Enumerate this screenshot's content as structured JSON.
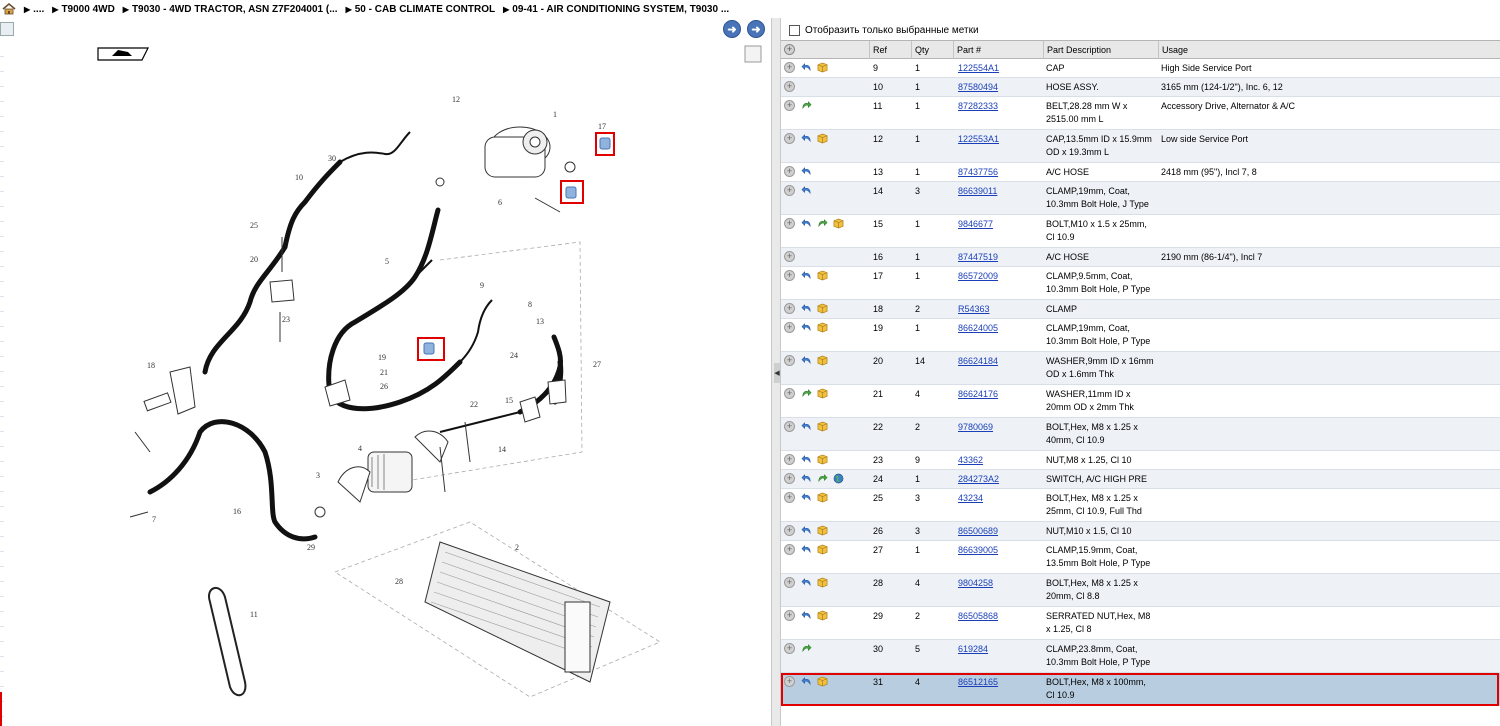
{
  "breadcrumb": {
    "items": [
      "....",
      "T9000 4WD",
      "T9030 - 4WD TRACTOR, ASN Z7F204001 (...",
      "50 - CAB CLIMATE CONTROL",
      "09-41 - AIR CONDITIONING SYSTEM, T9030 ..."
    ]
  },
  "icons": {
    "home": "home-icon",
    "back": "arrow-left-icon",
    "forward": "arrow-right-icon",
    "expand": "plus-circle-icon",
    "alternate": "blue-arrow-icon",
    "replacement": "green-arrow-icon",
    "package": "package-icon",
    "globe": "globe-icon"
  },
  "colors": {
    "accent": "#4a74b8",
    "link": "#1a3fb8",
    "highlight": "#e00000",
    "selected_row": "#b9cde0"
  },
  "filter": {
    "label": "Отобразить только выбранные метки",
    "checked": false
  },
  "table": {
    "columns": [
      "Ref",
      "Qty",
      "Part #",
      "Part Description",
      "Usage"
    ],
    "rows": [
      {
        "ref": "9",
        "qty": "1",
        "part": "122554A1",
        "desc": "CAP",
        "usage": "High Side Service Port",
        "icons": [
          "blue",
          "pkg"
        ]
      },
      {
        "ref": "10",
        "qty": "1",
        "part": "87580494",
        "desc": "HOSE ASSY.",
        "usage": "3165 mm (124-1/2\"), Inc. 6, 12",
        "icons": []
      },
      {
        "ref": "11",
        "qty": "1",
        "part": "87282333",
        "desc": "BELT,28.28 mm W x 2515.00 mm L",
        "usage": "Accessory Drive, Alternator & A/C",
        "icons": [
          "green"
        ]
      },
      {
        "ref": "12",
        "qty": "1",
        "part": "122553A1",
        "desc": "CAP,13.5mm ID x 15.9mm OD x 19.3mm L",
        "usage": "Low side Service Port",
        "icons": [
          "blue",
          "pkg"
        ]
      },
      {
        "ref": "13",
        "qty": "1",
        "part": "87437756",
        "desc": "A/C HOSE",
        "usage": "2418 mm (95\"), Incl 7, 8",
        "icons": [
          "blue"
        ]
      },
      {
        "ref": "14",
        "qty": "3",
        "part": "86639011",
        "desc": "CLAMP,19mm, Coat, 10.3mm Bolt Hole, J Type",
        "usage": "",
        "icons": [
          "blue"
        ]
      },
      {
        "ref": "15",
        "qty": "1",
        "part": "9846677",
        "desc": "BOLT,M10 x 1.5 x 25mm, Cl 10.9",
        "usage": "",
        "icons": [
          "blue",
          "green",
          "pkg"
        ]
      },
      {
        "ref": "16",
        "qty": "1",
        "part": "87447519",
        "desc": "A/C HOSE",
        "usage": "2190 mm (86-1/4\"), Incl 7",
        "icons": []
      },
      {
        "ref": "17",
        "qty": "1",
        "part": "86572009",
        "desc": "CLAMP,9.5mm, Coat, 10.3mm Bolt Hole, P Type",
        "usage": "",
        "icons": [
          "blue",
          "pkg"
        ]
      },
      {
        "ref": "18",
        "qty": "2",
        "part": "R54363",
        "desc": "CLAMP",
        "usage": "",
        "icons": [
          "blue",
          "pkg"
        ]
      },
      {
        "ref": "19",
        "qty": "1",
        "part": "86624005",
        "desc": "CLAMP,19mm, Coat, 10.3mm Bolt Hole, P Type",
        "usage": "",
        "icons": [
          "blue",
          "pkg"
        ]
      },
      {
        "ref": "20",
        "qty": "14",
        "part": "86624184",
        "desc": "WASHER,9mm ID x 16mm OD x 1.6mm Thk",
        "usage": "",
        "icons": [
          "blue",
          "pkg"
        ]
      },
      {
        "ref": "21",
        "qty": "4",
        "part": "86624176",
        "desc": "WASHER,11mm ID x 20mm OD x 2mm Thk",
        "usage": "",
        "icons": [
          "green",
          "pkg"
        ]
      },
      {
        "ref": "22",
        "qty": "2",
        "part": "9780069",
        "desc": "BOLT,Hex, M8 x 1.25 x 40mm, Cl 10.9",
        "usage": "",
        "icons": [
          "blue",
          "pkg"
        ]
      },
      {
        "ref": "23",
        "qty": "9",
        "part": "43362",
        "desc": "NUT,M8 x 1.25, Cl 10",
        "usage": "",
        "icons": [
          "blue",
          "pkg"
        ]
      },
      {
        "ref": "24",
        "qty": "1",
        "part": "284273A2",
        "desc": "SWITCH, A/C HIGH PRE",
        "usage": "",
        "icons": [
          "blue",
          "green",
          "globe"
        ]
      },
      {
        "ref": "25",
        "qty": "3",
        "part": "43234",
        "desc": "BOLT,Hex, M8 x 1.25 x 25mm, Cl 10.9, Full Thd",
        "usage": "",
        "icons": [
          "blue",
          "pkg"
        ]
      },
      {
        "ref": "26",
        "qty": "3",
        "part": "86500689",
        "desc": "NUT,M10 x 1.5, Cl 10",
        "usage": "",
        "icons": [
          "blue",
          "pkg"
        ]
      },
      {
        "ref": "27",
        "qty": "1",
        "part": "86639005",
        "desc": "CLAMP,15.9mm, Coat, 13.5mm Bolt Hole, P Type",
        "usage": "",
        "icons": [
          "blue",
          "pkg"
        ]
      },
      {
        "ref": "28",
        "qty": "4",
        "part": "9804258",
        "desc": "BOLT,Hex, M8 x 1.25 x 20mm, Cl 8.8",
        "usage": "",
        "icons": [
          "blue",
          "pkg"
        ]
      },
      {
        "ref": "29",
        "qty": "2",
        "part": "86505868",
        "desc": "SERRATED NUT,Hex, M8 x 1.25, Cl 8",
        "usage": "",
        "icons": [
          "blue",
          "pkg"
        ]
      },
      {
        "ref": "30",
        "qty": "5",
        "part": "619284",
        "desc": "CLAMP,23.8mm, Coat, 10.3mm Bolt Hole, P Type",
        "usage": "",
        "icons": [
          "green"
        ]
      },
      {
        "ref": "31",
        "qty": "4",
        "part": "86512165",
        "desc": "BOLT,Hex, M8 x 100mm, Cl 10.9",
        "usage": "",
        "icons": [
          "blue",
          "pkg"
        ],
        "selected": true
      }
    ]
  },
  "diagram": {
    "callouts": [
      "1",
      "2",
      "3",
      "4",
      "5",
      "6",
      "7",
      "8",
      "9",
      "10",
      "11",
      "12",
      "13",
      "14",
      "15",
      "16",
      "17",
      "18",
      "19",
      "20",
      "21",
      "22",
      "23",
      "24",
      "25",
      "26",
      "27",
      "28",
      "29",
      "30"
    ]
  }
}
